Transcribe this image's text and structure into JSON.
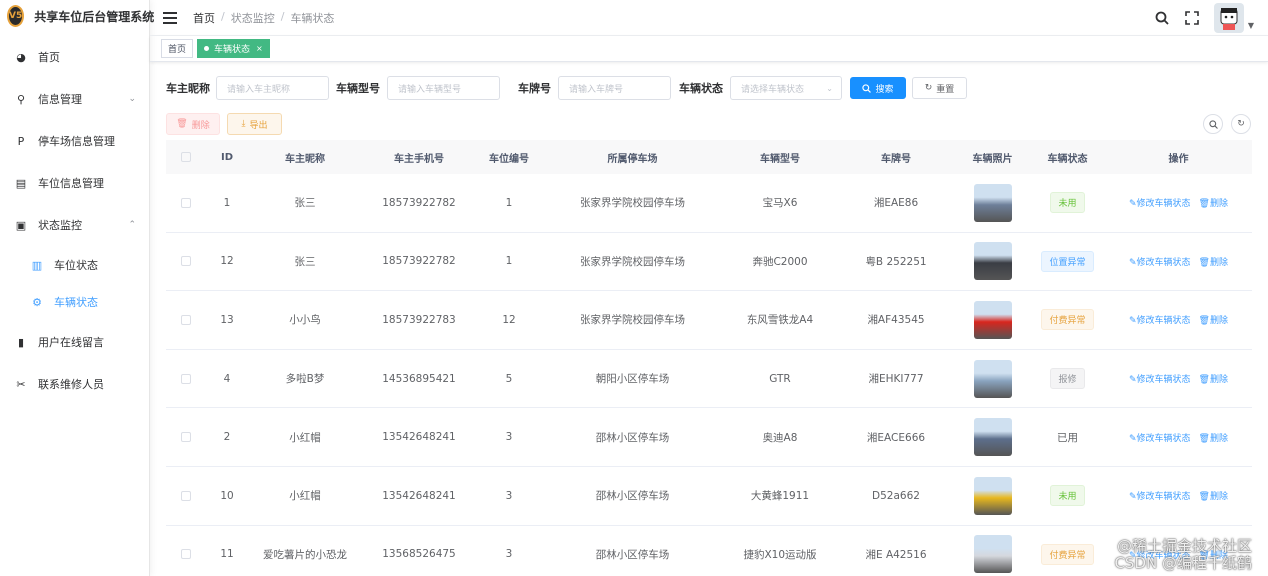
{
  "app": {
    "title": "共享车位后台管理系统",
    "logo_text": "V5"
  },
  "sidebar": {
    "items": [
      {
        "label": "首页",
        "icon": "dashboard-icon",
        "glyph": "◕"
      },
      {
        "label": "信息管理",
        "icon": "key-icon",
        "glyph": "⚲",
        "arrow": "⌄"
      },
      {
        "label": "停车场信息管理",
        "icon": "parking-icon",
        "glyph": "P"
      },
      {
        "label": "车位信息管理",
        "icon": "form-icon",
        "glyph": "▤"
      },
      {
        "label": "状态监控",
        "icon": "monitor-icon",
        "glyph": "▣",
        "arrow": "⌃"
      },
      {
        "label": "车位状态",
        "icon": "calendar-icon",
        "glyph": "▥"
      },
      {
        "label": "车辆状态",
        "icon": "car-status-icon",
        "glyph": "⚙"
      },
      {
        "label": "用户在线留言",
        "icon": "book-icon",
        "glyph": "▮"
      },
      {
        "label": "联系维修人员",
        "icon": "tool-icon",
        "glyph": "✂"
      }
    ]
  },
  "header": {
    "breadcrumb": [
      "首页",
      "状态监控",
      "车辆状态"
    ],
    "separator": "/"
  },
  "tags": [
    {
      "label": "首页"
    },
    {
      "label": "车辆状态",
      "close": "×"
    }
  ],
  "filters": {
    "owner_label": "车主昵称",
    "owner_placeholder": "请输入车主昵称",
    "model_label": "车辆型号",
    "model_placeholder": "请输入车辆型号",
    "plate_label": "车牌号",
    "plate_placeholder": "请输入车牌号",
    "status_label": "车辆状态",
    "status_placeholder": "请选择车辆状态",
    "search_btn": "搜索",
    "reset_btn": "重置"
  },
  "toolbar": {
    "delete_btn": "删除",
    "export_btn": "导出"
  },
  "table": {
    "columns": [
      "ID",
      "车主昵称",
      "车主手机号",
      "车位编号",
      "所属停车场",
      "车辆型号",
      "车牌号",
      "车辆照片",
      "车辆状态",
      "操作"
    ],
    "edit_label": "修改车辆状态",
    "delete_label": "删除",
    "rows": [
      {
        "id": "1",
        "owner": "张三",
        "phone": "18573922782",
        "space": "1",
        "lot": "张家界学院校园停车场",
        "model": "宝马X6",
        "plate": "湘EAE86",
        "status": "未用",
        "status_style": "success",
        "photo": "#6e7f99"
      },
      {
        "id": "12",
        "owner": "张三",
        "phone": "18573922782",
        "space": "1",
        "lot": "张家界学院校园停车场",
        "model": "奔驰C2000",
        "plate": "粤B 252251",
        "status": "位置异常",
        "status_style": "info",
        "photo": "#3a3d44"
      },
      {
        "id": "13",
        "owner": "小小鸟",
        "phone": "18573922783",
        "space": "12",
        "lot": "张家界学院校园停车场",
        "model": "东风雪铁龙A4",
        "plate": "湘AF43545",
        "status": "付费异常",
        "status_style": "warning",
        "photo": "#d8261e"
      },
      {
        "id": "4",
        "owner": "多啦B梦",
        "phone": "14536895421",
        "space": "5",
        "lot": "朝阳小区停车场",
        "model": "GTR",
        "plate": "湘EHKI777",
        "status": "报修",
        "status_style": "gray",
        "photo": "#8aa4bf"
      },
      {
        "id": "2",
        "owner": "小红帽",
        "phone": "13542648241",
        "space": "3",
        "lot": "邵林小区停车场",
        "model": "奥迪A8",
        "plate": "湘EACE666",
        "status": "已用",
        "status_style": "plain",
        "photo": "#5d6f8c"
      },
      {
        "id": "10",
        "owner": "小红帽",
        "phone": "13542648241",
        "space": "3",
        "lot": "邵林小区停车场",
        "model": "大黄蜂1911",
        "plate": "D52a662",
        "status": "未用",
        "status_style": "success",
        "photo": "#e8b81e"
      },
      {
        "id": "11",
        "owner": "爱吃薯片的小恐龙",
        "phone": "13568526475",
        "space": "3",
        "lot": "邵林小区停车场",
        "model": "捷豹X10运动版",
        "plate": "湘E A42516",
        "status": "付费异常",
        "status_style": "warning",
        "photo": "#d5d8de"
      }
    ]
  },
  "watermark": {
    "line1": "@稀土掘金技术社区",
    "line2": "CSDN @编程千纸鹤"
  },
  "colors": {
    "primary": "#1890ff",
    "tag_active": "#42b983",
    "link": "#409eff"
  }
}
